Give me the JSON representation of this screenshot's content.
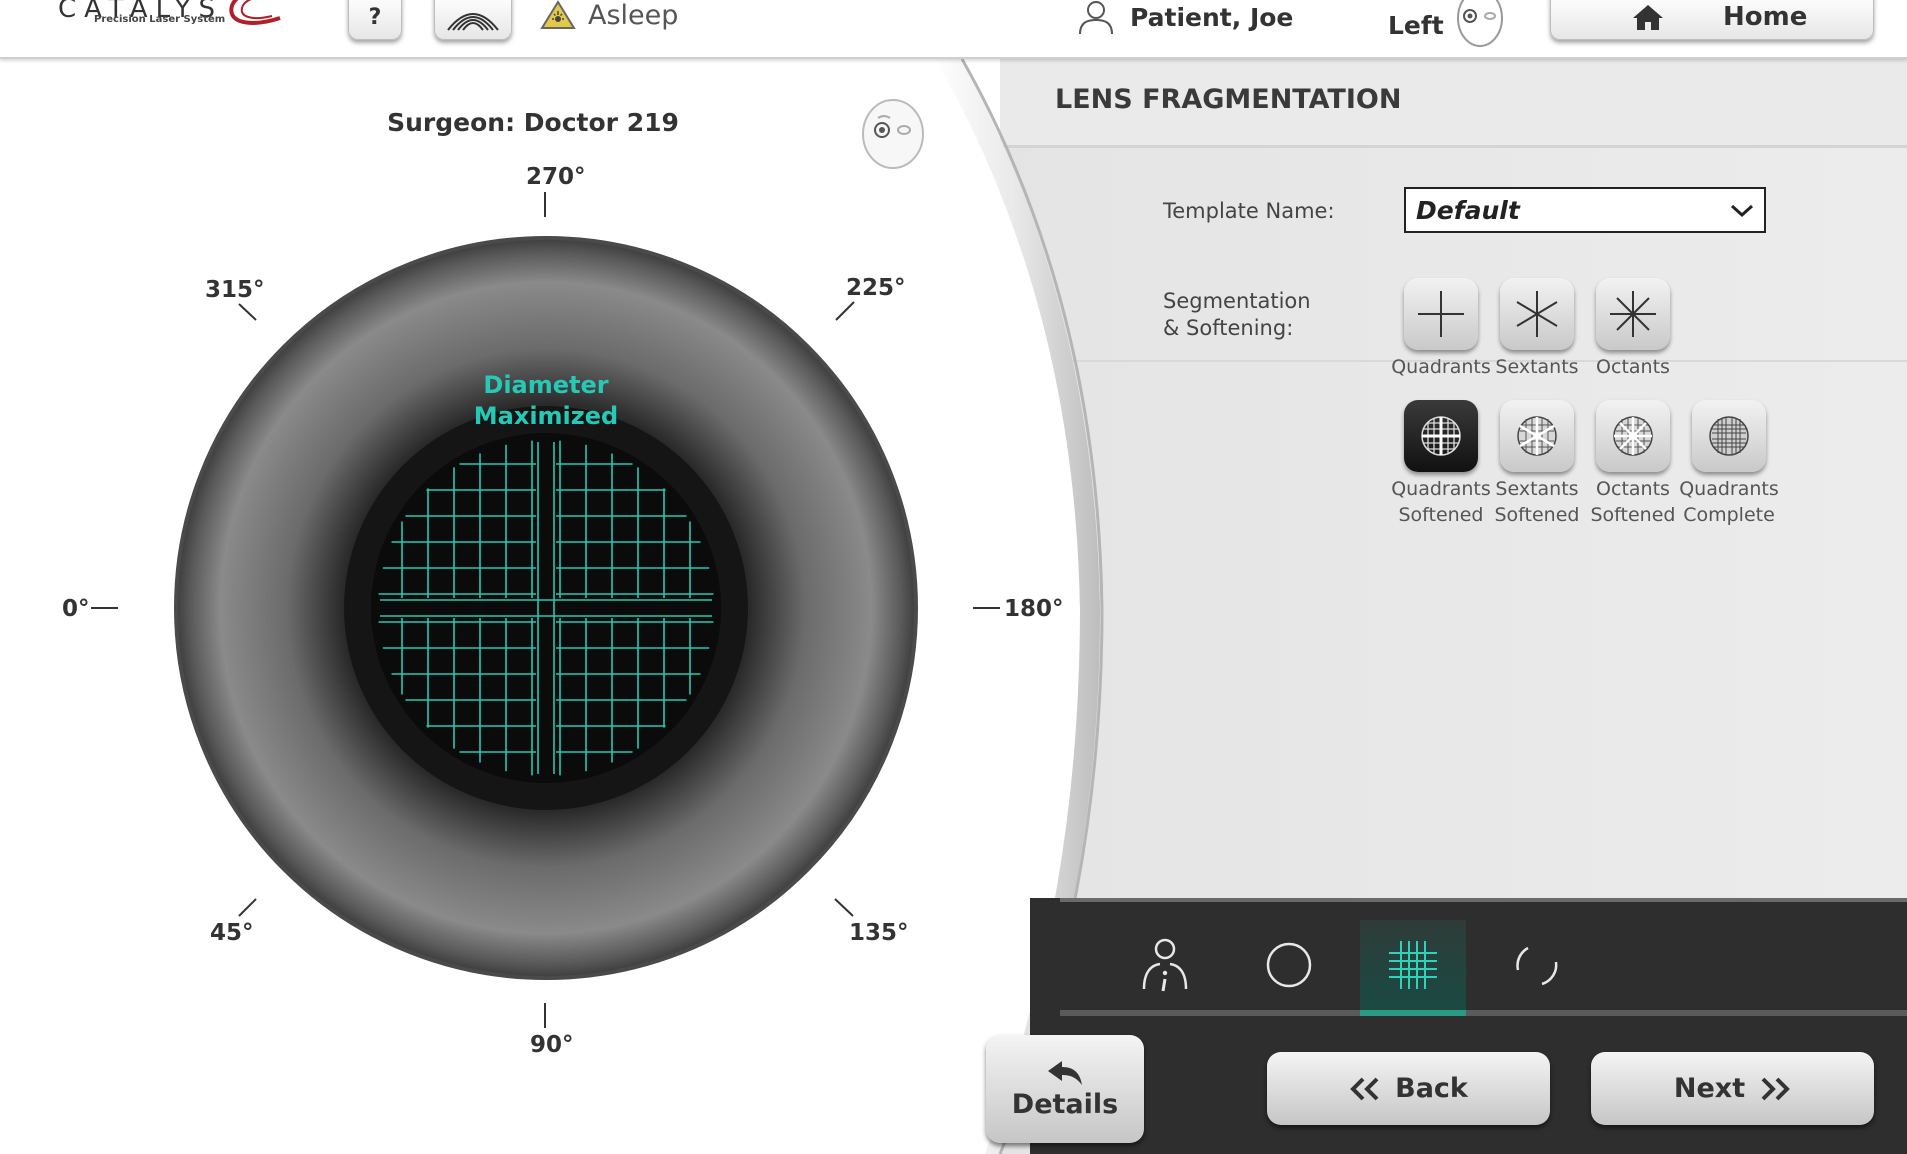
{
  "app": {
    "brand": "CATALYS",
    "brand_mark": "®",
    "tagline": "Precision Laser System"
  },
  "topbar": {
    "help_label": "?",
    "status_text": "Asleep",
    "patient_name": "Patient, Joe",
    "eye_side": "Left",
    "home_label": "Home"
  },
  "left_panel": {
    "surgeon": "Surgeon: Doctor 219",
    "diameter_line1": "Diameter",
    "diameter_line2": "Maximized",
    "angles": {
      "a270": "270°",
      "a315": "315°",
      "a225": "225°",
      "a0": "0°",
      "a180": "180°",
      "a45": "45°",
      "a135": "135°",
      "a90": "90°"
    }
  },
  "right_panel": {
    "title": "LENS FRAGMENTATION",
    "template_label": "Template Name:",
    "template_value": "Default",
    "segmentation_label_1": "Segmentation",
    "segmentation_label_2": "& Softening:",
    "patterns": [
      {
        "line1": "Quadrants",
        "line2": ""
      },
      {
        "line1": "Sextants",
        "line2": ""
      },
      {
        "line1": "Octants",
        "line2": ""
      },
      {
        "line1": "Quadrants",
        "line2": "Softened"
      },
      {
        "line1": "Sextants",
        "line2": "Softened"
      },
      {
        "line1": "Octants",
        "line2": "Softened"
      },
      {
        "line1": "Quadrants",
        "line2": "Complete"
      }
    ],
    "selected_pattern": 3
  },
  "bottom": {
    "details_label": "Details",
    "back_label": "Back",
    "next_label": "Next"
  },
  "colors": {
    "accent": "#25c9b5",
    "dark_bar": "#2e2e2e"
  }
}
